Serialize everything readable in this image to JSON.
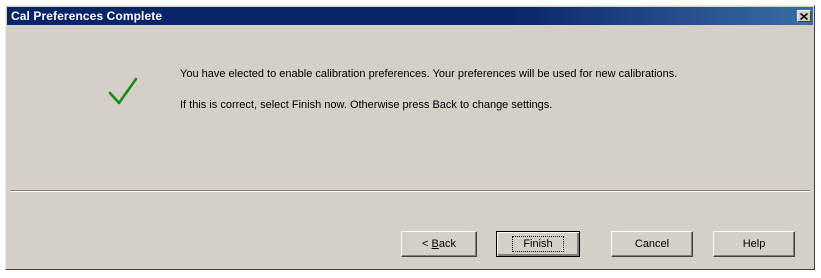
{
  "window": {
    "title": "Cal Preferences Complete"
  },
  "icons": {
    "close": "close-icon",
    "status": "checkmark-icon",
    "check_color": "#1a8c1a"
  },
  "message": {
    "line1": "You have elected to enable calibration preferences.  Your preferences will be used for new calibrations.",
    "line2": "If this is correct, select Finish now.  Otherwise press Back to change settings."
  },
  "buttons": {
    "back_prefix": "< ",
    "back_mnemonic": "B",
    "back_rest": "ack",
    "finish": "Finish",
    "cancel": "Cancel",
    "help": "Help"
  }
}
